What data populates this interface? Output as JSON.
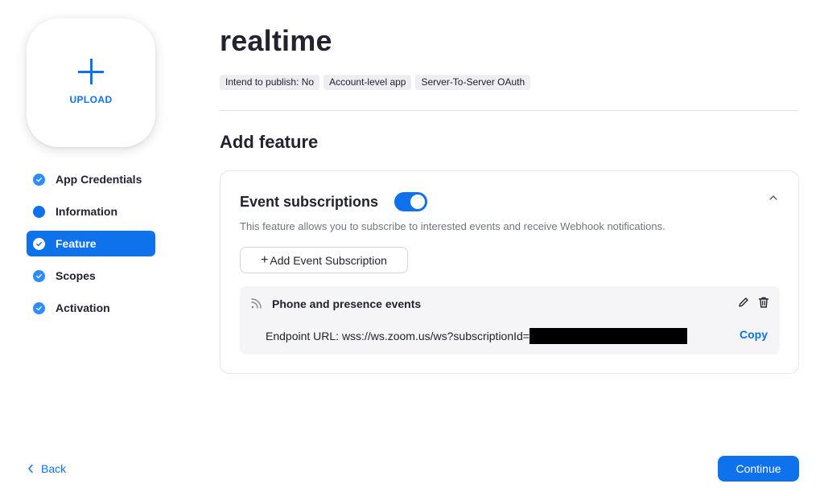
{
  "sidebar": {
    "upload_label": "UPLOAD",
    "items": [
      {
        "label": "App Credentials",
        "state": "completed"
      },
      {
        "label": "Information",
        "state": "in-progress"
      },
      {
        "label": "Feature",
        "state": "active"
      },
      {
        "label": "Scopes",
        "state": "completed"
      },
      {
        "label": "Activation",
        "state": "completed"
      }
    ]
  },
  "header": {
    "title": "realtime",
    "tags": [
      "Intend to publish: No",
      "Account-level app",
      "Server-To-Server OAuth"
    ]
  },
  "main": {
    "section_title": "Add feature",
    "event_card": {
      "title": "Event subscriptions",
      "toggle_on": true,
      "description": "This feature allows you to subscribe to interested events and receive Webhook notifications.",
      "add_button_label": "Add Event Subscription",
      "subscription": {
        "title": "Phone and presence events",
        "endpoint_text": "Endpoint URL: wss://ws.zoom.us/ws?subscriptionId=",
        "copy_label": "Copy"
      }
    }
  },
  "footer": {
    "back_label": "Back",
    "continue_label": "Continue"
  },
  "colors": {
    "accent": "#0e72ed",
    "tag_bg": "#ededf2",
    "subscription_bg": "#f5f5f8"
  },
  "icons": {
    "upload": "plus-icon",
    "completed": "check-circle-icon",
    "in_progress": "dot-icon",
    "subscription": "rss-icon",
    "edit": "pencil-icon",
    "delete": "trash-icon",
    "collapse": "chevron-up-icon",
    "back": "chevron-left-icon"
  }
}
